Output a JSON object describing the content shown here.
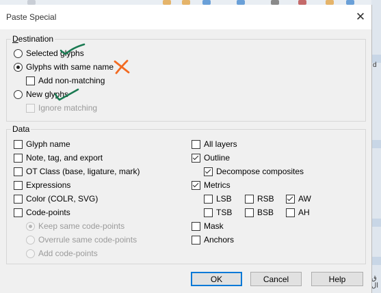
{
  "dialog": {
    "title": "Paste Special",
    "close_glyph": "✕"
  },
  "background": {
    "right_label_1": "d",
    "right_label_2": "ق ال"
  },
  "destination": {
    "legend": "Destination",
    "legend_accel": "D",
    "legend_rest": "estination",
    "options": {
      "selected_glyphs": {
        "label": "Selected glyphs",
        "checked": false
      },
      "same_name": {
        "label": "Glyphs with same name",
        "checked": true
      },
      "add_non_matching": {
        "label": "Add non-matching",
        "checked": false
      },
      "new_glyphs": {
        "label": "New glyphs",
        "checked": false
      },
      "ignore_matching": {
        "label": "Ignore matching",
        "checked": false,
        "disabled": true
      }
    }
  },
  "data": {
    "legend": "Data",
    "left": {
      "glyph_name": {
        "label": "Glyph name",
        "checked": false
      },
      "note_tag_export": {
        "label": "Note, tag, and export",
        "checked": false
      },
      "ot_class": {
        "label": "OT Class (base, ligature, mark)",
        "checked": false
      },
      "expressions": {
        "label": "Expressions",
        "checked": false
      },
      "color": {
        "label": "Color (COLR, SVG)",
        "checked": false
      },
      "code_points": {
        "label": "Code-points",
        "checked": false
      },
      "keep_same": {
        "label": "Keep same code-points",
        "checked": true,
        "disabled": true
      },
      "overrule_same": {
        "label": "Overrule same code-points",
        "checked": false,
        "disabled": true
      },
      "add_code_points": {
        "label": "Add code-points",
        "checked": false,
        "disabled": true
      }
    },
    "right": {
      "all_layers": {
        "label": "All layers",
        "checked": false
      },
      "outline": {
        "label": "Outline",
        "checked": true
      },
      "decompose": {
        "label": "Decompose composites",
        "checked": true
      },
      "metrics": {
        "label": "Metrics",
        "checked": true
      },
      "lsb": {
        "label": "LSB",
        "checked": false
      },
      "rsb": {
        "label": "RSB",
        "checked": false
      },
      "aw": {
        "label": "AW",
        "checked": true
      },
      "tsb": {
        "label": "TSB",
        "checked": false
      },
      "bsb": {
        "label": "BSB",
        "checked": false
      },
      "ah": {
        "label": "AH",
        "checked": false
      },
      "mask": {
        "label": "Mask",
        "checked": false
      },
      "anchors": {
        "label": "Anchors",
        "checked": false
      }
    }
  },
  "buttons": {
    "ok": "OK",
    "cancel": "Cancel",
    "help": "Help"
  },
  "annotations": {
    "check_color": "#1a7a52",
    "cross_color": "#f26a21"
  }
}
